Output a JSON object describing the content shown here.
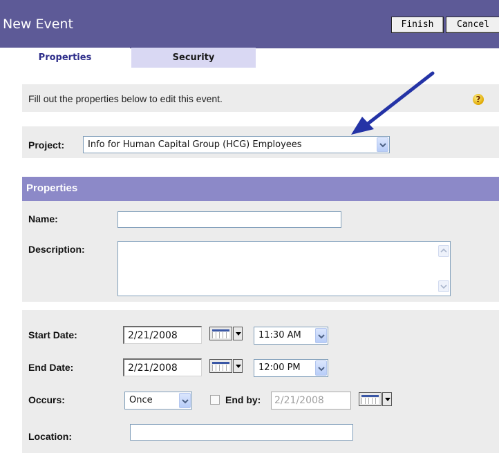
{
  "header": {
    "title": "New Event",
    "finish_label": "Finish",
    "cancel_label": "Cancel"
  },
  "tabs": [
    {
      "label": "Properties",
      "active": true
    },
    {
      "label": "Security",
      "active": false
    }
  ],
  "intro": {
    "text": "Fill out the properties below to edit this event.",
    "help_icon": "help-question-icon"
  },
  "project": {
    "label": "Project:",
    "value": "Info for Human Capital Group (HCG) Employees"
  },
  "properties_section": {
    "heading": "Properties",
    "name_label": "Name:",
    "name_value": "",
    "description_label": "Description:",
    "description_value": ""
  },
  "schedule": {
    "start_date_label": "Start Date:",
    "start_date": "2/21/2008",
    "start_time": "11:30 AM",
    "end_date_label": "End Date:",
    "end_date": "2/21/2008",
    "end_time": "12:00 PM",
    "occurs_label": "Occurs:",
    "occurs_value": "Once",
    "end_by_label": "End by:",
    "end_by_checked": false,
    "end_by_date": "2/21/2008",
    "location_label": "Location:",
    "location_value": ""
  },
  "colors": {
    "header_bg": "#5d5a97",
    "section_header_bg": "#8c89c8",
    "tab_inactive_bg": "#d9d8f3",
    "arrow": "#2433a6"
  },
  "icons": [
    "help-question-icon",
    "calendar-icon",
    "chevron-down-icon",
    "annotation-arrow"
  ]
}
